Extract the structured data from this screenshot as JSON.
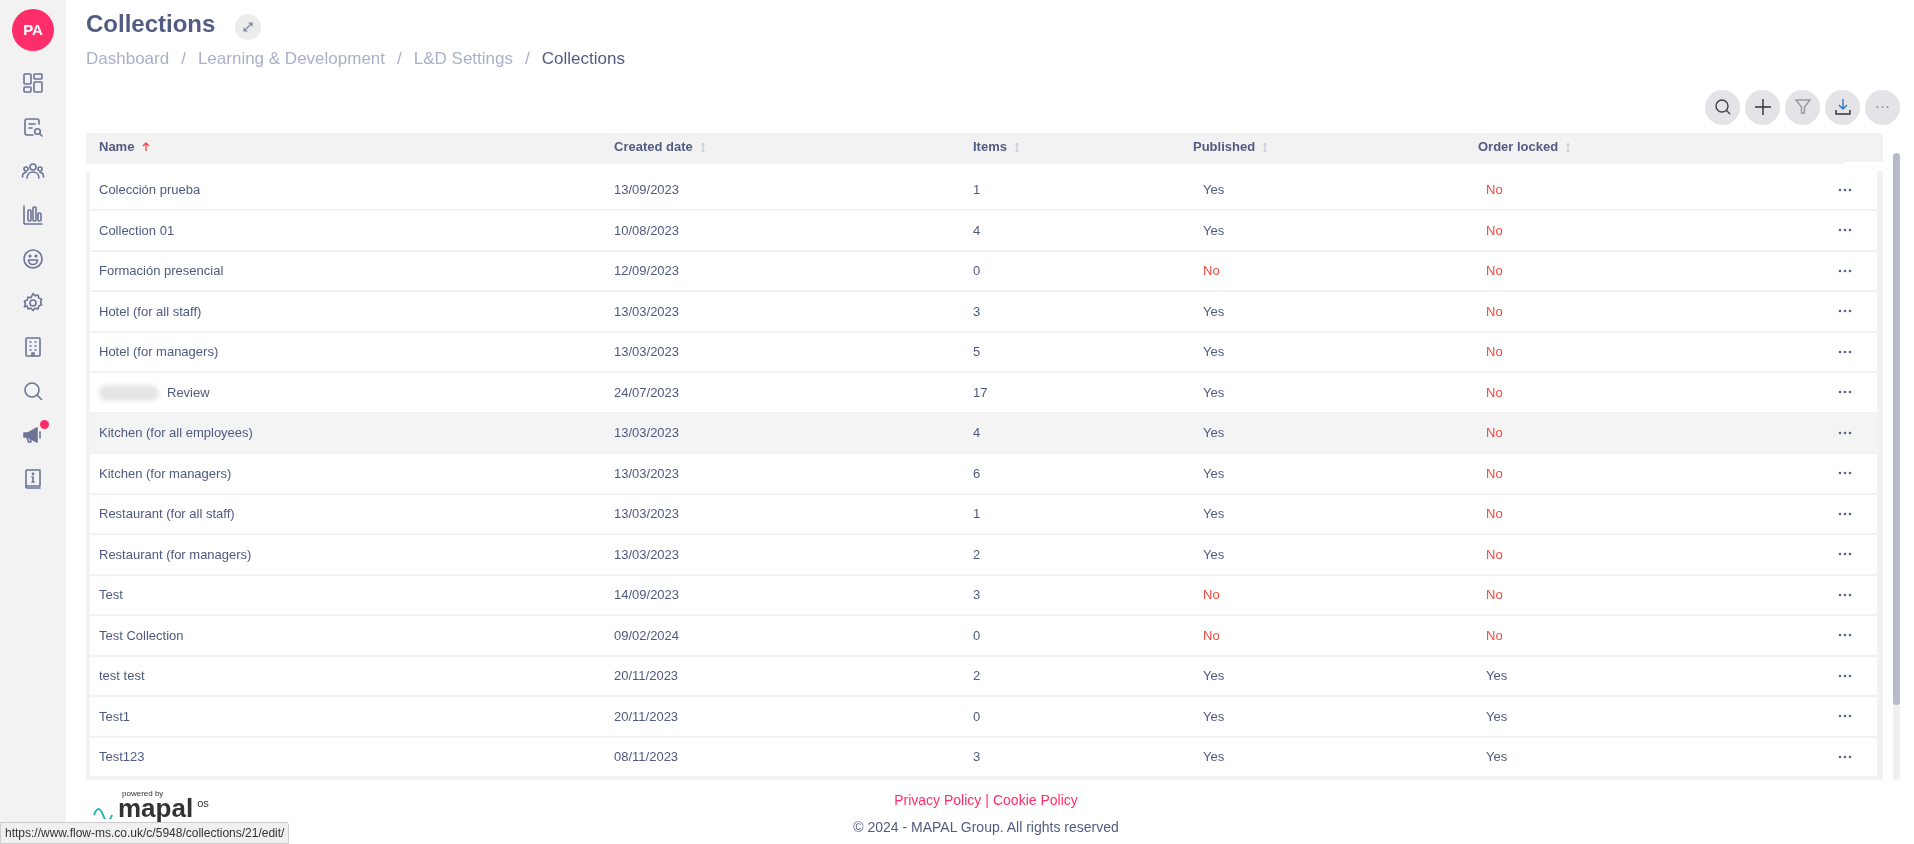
{
  "sidebar": {
    "avatar_initials": "PA",
    "notification_dot": true
  },
  "page": {
    "title": "Collections"
  },
  "breadcrumb": [
    {
      "label": "Dashboard",
      "current": false
    },
    {
      "label": "Learning & Development",
      "current": false
    },
    {
      "label": "L&D Settings",
      "current": false
    },
    {
      "label": "Collections",
      "current": true
    }
  ],
  "breadcrumb_separator": "/",
  "table": {
    "columns": [
      {
        "label": "Name",
        "sorted": true
      },
      {
        "label": "Created date",
        "sorted": false
      },
      {
        "label": "Items",
        "sorted": false
      },
      {
        "label": "Published",
        "sorted": false
      },
      {
        "label": "Order locked",
        "sorted": false
      }
    ],
    "rows": [
      {
        "name": "Colección prueba",
        "redacted": false,
        "created": "13/09/2023",
        "items": "1",
        "published": {
          "text": "Yes",
          "on": true
        },
        "order_locked": {
          "text": "No",
          "on": false
        },
        "highlighted": false
      },
      {
        "name": "Collection 01",
        "redacted": false,
        "created": "10/08/2023",
        "items": "4",
        "published": {
          "text": "Yes",
          "on": true
        },
        "order_locked": {
          "text": "No",
          "on": false
        },
        "highlighted": false
      },
      {
        "name": "Formación presencial",
        "redacted": false,
        "created": "12/09/2023",
        "items": "0",
        "published": {
          "text": "No",
          "on": false
        },
        "order_locked": {
          "text": "No",
          "on": false
        },
        "highlighted": false
      },
      {
        "name": "Hotel (for all staff)",
        "redacted": false,
        "created": "13/03/2023",
        "items": "3",
        "published": {
          "text": "Yes",
          "on": true
        },
        "order_locked": {
          "text": "No",
          "on": false
        },
        "highlighted": false
      },
      {
        "name": "Hotel (for managers)",
        "redacted": false,
        "created": "13/03/2023",
        "items": "5",
        "published": {
          "text": "Yes",
          "on": true
        },
        "order_locked": {
          "text": "No",
          "on": false
        },
        "highlighted": false
      },
      {
        "name": "Review",
        "redacted": true,
        "created": "24/07/2023",
        "items": "17",
        "published": {
          "text": "Yes",
          "on": true
        },
        "order_locked": {
          "text": "No",
          "on": false
        },
        "highlighted": false
      },
      {
        "name": "Kitchen (for all employees)",
        "redacted": false,
        "created": "13/03/2023",
        "items": "4",
        "published": {
          "text": "Yes",
          "on": true
        },
        "order_locked": {
          "text": "No",
          "on": false
        },
        "highlighted": true
      },
      {
        "name": "Kitchen (for managers)",
        "redacted": false,
        "created": "13/03/2023",
        "items": "6",
        "published": {
          "text": "Yes",
          "on": true
        },
        "order_locked": {
          "text": "No",
          "on": false
        },
        "highlighted": false
      },
      {
        "name": "Restaurant (for all staff)",
        "redacted": false,
        "created": "13/03/2023",
        "items": "1",
        "published": {
          "text": "Yes",
          "on": true
        },
        "order_locked": {
          "text": "No",
          "on": false
        },
        "highlighted": false
      },
      {
        "name": "Restaurant (for managers)",
        "redacted": false,
        "created": "13/03/2023",
        "items": "2",
        "published": {
          "text": "Yes",
          "on": true
        },
        "order_locked": {
          "text": "No",
          "on": false
        },
        "highlighted": false
      },
      {
        "name": "Test",
        "redacted": false,
        "created": "14/09/2023",
        "items": "3",
        "published": {
          "text": "No",
          "on": false
        },
        "order_locked": {
          "text": "No",
          "on": false
        },
        "highlighted": false
      },
      {
        "name": "Test Collection",
        "redacted": false,
        "created": "09/02/2024",
        "items": "0",
        "published": {
          "text": "No",
          "on": false
        },
        "order_locked": {
          "text": "No",
          "on": false
        },
        "highlighted": false
      },
      {
        "name": "test test",
        "redacted": false,
        "created": "20/11/2023",
        "items": "2",
        "published": {
          "text": "Yes",
          "on": true
        },
        "order_locked": {
          "text": "Yes",
          "on": true
        },
        "highlighted": false
      },
      {
        "name": "Test1",
        "redacted": false,
        "created": "20/11/2023",
        "items": "0",
        "published": {
          "text": "Yes",
          "on": true
        },
        "order_locked": {
          "text": "Yes",
          "on": true
        },
        "highlighted": false
      },
      {
        "name": "Test123",
        "redacted": false,
        "created": "08/11/2023",
        "items": "3",
        "published": {
          "text": "Yes",
          "on": true
        },
        "order_locked": {
          "text": "Yes",
          "on": true
        },
        "highlighted": false
      }
    ]
  },
  "footer": {
    "powered_by": "powered by",
    "logo_word": "mapal",
    "logo_suffix": "os",
    "links": [
      "Privacy Policy",
      "Cookie Policy"
    ],
    "link_separator": "|",
    "copyright": "© 2024 - MAPAL Group. All rights reserved"
  },
  "status_url": "https://www.flow-ms.co.uk/c/5948/collections/21/edit/"
}
